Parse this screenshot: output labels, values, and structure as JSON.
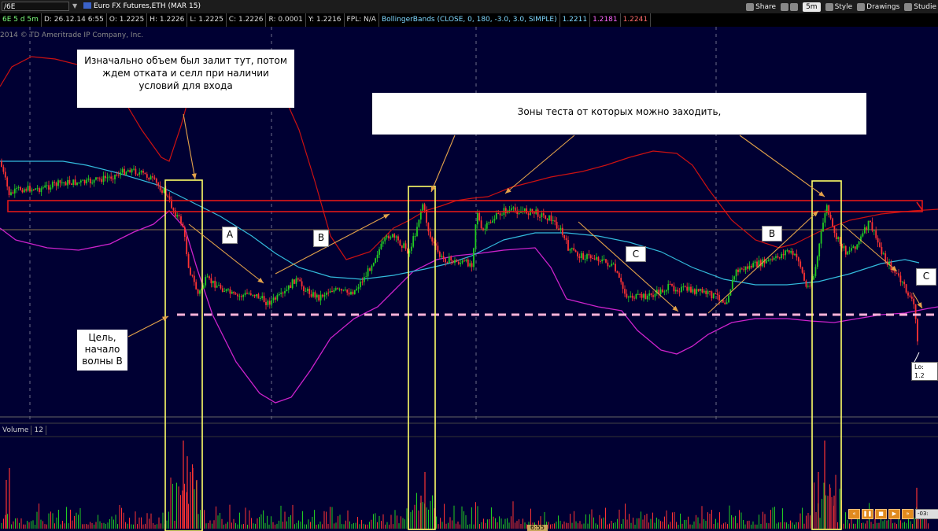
{
  "toolbar": {
    "symbol": "/6E",
    "instrument": "Euro FX Futures,ETH (MAR 15)",
    "share_label": "Share",
    "timeframe_label": "5m",
    "style_label": "Style",
    "drawings_label": "Drawings",
    "studies_label": "Studie"
  },
  "info": {
    "period": "6E 5 d 5m",
    "date": "D: 26.12.14 6:55",
    "open": "O: 1.2225",
    "high": "H: 1.2226",
    "low": "L: 1.2225",
    "close": "C: 1.2226",
    "range": "R: 0.0001",
    "y": "Y: 1.2216",
    "fpl": "FPL: N/A",
    "study": "BollingerBands (CLOSE, 0, 180, -3.0, 3.0, SIMPLE)",
    "bb_mid": "1.2211",
    "bb_low": "1.2181",
    "bb_high": "1.2241"
  },
  "copyright": "2014 © TD Ameritrade IP Company, Inc.",
  "annotations": {
    "note1": "Изначально объем был залит тут, потом ждем отката и селл при наличии условий для входа",
    "note2": "Зоны теста от которых можно заходить,",
    "note3": "Цель, начало волны В",
    "wave_a": "A",
    "wave_b1": "B",
    "wave_c1": "C",
    "wave_b2": "B",
    "wave_c2": "C"
  },
  "volume": {
    "label": "Volume",
    "value": "12"
  },
  "lo_badge": "Lo: 1.2",
  "time_marker": "6:55",
  "playback_time": "-03:",
  "colors": {
    "background": "#000033",
    "candle_up": "#22cc22",
    "candle_down": "#ff3333",
    "bb_upper": "#cc1111",
    "bb_lower": "#cc22cc",
    "ma_line": "#33bbdd",
    "highlight_box": "#ffff66",
    "target_dash": "#ffb3d9"
  }
}
